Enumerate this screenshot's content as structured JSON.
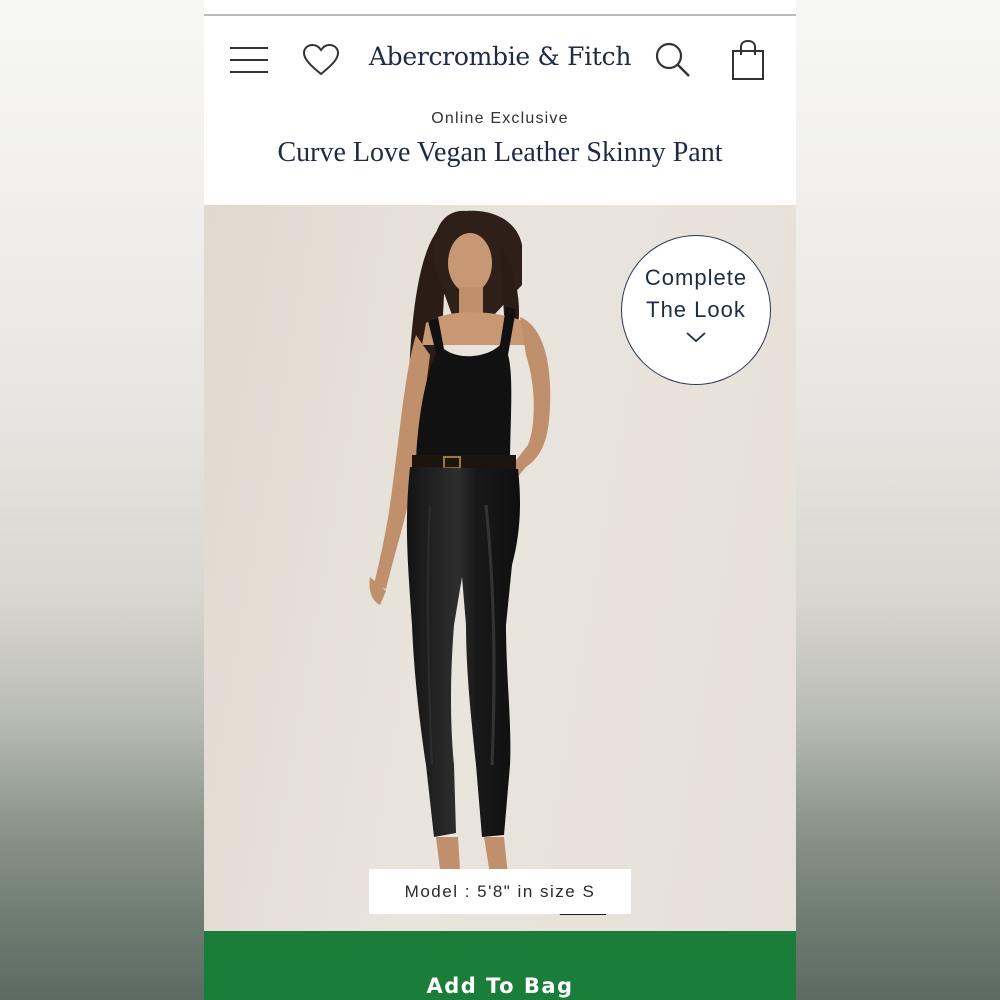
{
  "header": {
    "brand": "Abercrombie & Fitch",
    "icons": {
      "menu": "hamburger-menu-icon",
      "wishlist": "heart-icon",
      "search": "search-icon",
      "bag": "shopping-bag-icon"
    }
  },
  "product": {
    "eyebrow": "Online Exclusive",
    "title": "Curve Love Vegan Leather Skinny Pant"
  },
  "hero": {
    "complete_look_line1": "Complete",
    "complete_look_line2": "The Look",
    "model_caption": "Model : 5'8\" in size S"
  },
  "cta": {
    "add_to_bag": "Add To Bag"
  },
  "colors": {
    "brand_navy": "#1f2a44",
    "cta_green": "#1a7e3a",
    "hero_background": "#e6e0d8"
  }
}
